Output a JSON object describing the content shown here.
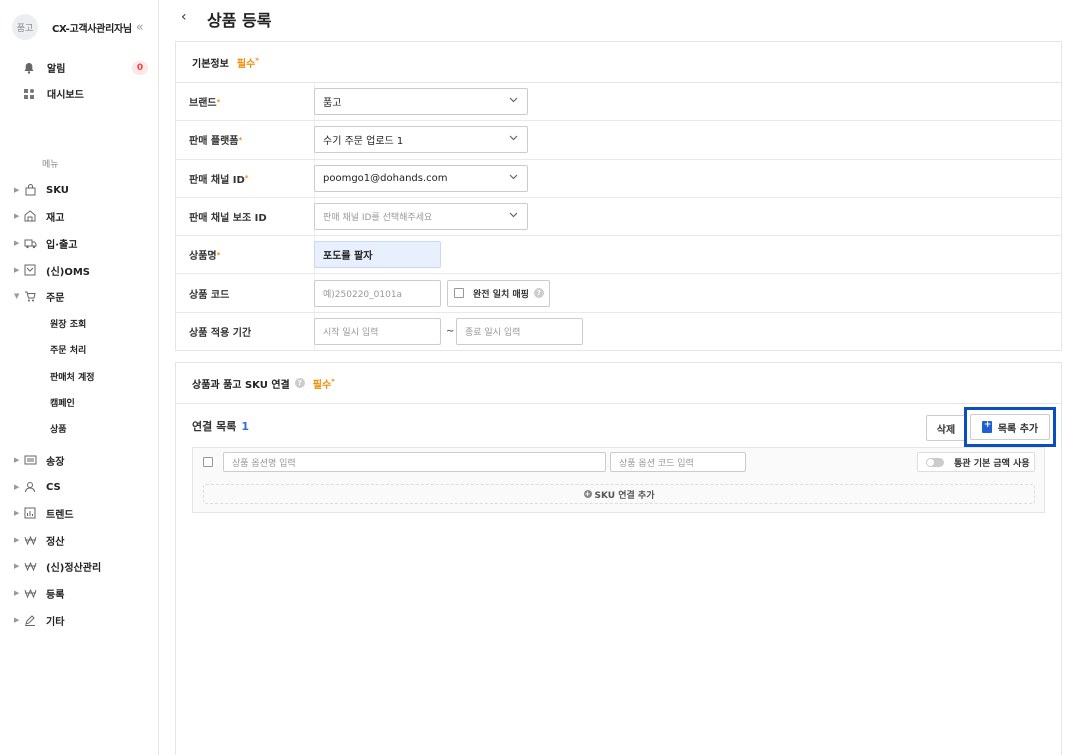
{
  "sidebar": {
    "avatar": "품고",
    "brand_name": "CX-고객사관리자님",
    "collapse": "«",
    "alerts": {
      "label": "알림",
      "count": "0"
    },
    "dashboard": {
      "label": "대시보드"
    },
    "menu_heading": "메뉴",
    "items": [
      {
        "label": "SKU",
        "icon": "bag-icon"
      },
      {
        "label": "재고",
        "icon": "warehouse-icon"
      },
      {
        "label": "입·출고",
        "icon": "truck-icon"
      },
      {
        "label": "(신)OMS",
        "icon": "oms-icon"
      },
      {
        "label": "주문",
        "icon": "cart-icon"
      },
      {
        "label": "송장",
        "icon": "invoice-icon"
      },
      {
        "label": "CS",
        "icon": "person-icon"
      },
      {
        "label": "트렌드",
        "icon": "chart-icon"
      },
      {
        "label": "정산",
        "icon": "won-icon"
      },
      {
        "label": "(신)정산관리",
        "icon": "won-icon"
      },
      {
        "label": "등록",
        "icon": "won-icon"
      },
      {
        "label": "기타",
        "icon": "pencil-icon"
      }
    ],
    "order_sub": [
      "원장 조회",
      "주문 처리",
      "판매처 계정",
      "캠페인",
      "상품"
    ]
  },
  "header": {
    "back": "‹",
    "title": "상품 등록"
  },
  "basic": {
    "title": "기본정보",
    "required": "필수",
    "brand": {
      "label": "브랜드",
      "value": "품고"
    },
    "platform": {
      "label": "판매 플랫폼",
      "value": "수기 주문 업로드 1"
    },
    "channel_id": {
      "label": "판매 채널 ID",
      "value": "poomgo1@dohands.com"
    },
    "sub_channel": {
      "label": "판매 채널 보조 ID",
      "placeholder": "판매 채널 ID를 선택해주세요"
    },
    "product_name": {
      "label": "상품명",
      "value": "포도를 팔자"
    },
    "product_code": {
      "label": "상품 코드",
      "placeholder": "예)250220_0101a",
      "exact_match": "완전 일치 매핑"
    },
    "period": {
      "label": "상품 적용 기간",
      "start_placeholder": "시작 일시 입력",
      "sep": "~",
      "end_placeholder": "종료 일시 입력"
    }
  },
  "link": {
    "title": "상품과 품고 SKU 연결",
    "required": "필수",
    "list_title": "연결 목록",
    "count": "1",
    "delete_label": "삭제",
    "add_label": "목록 추가",
    "option_name_placeholder": "상품 옵션명 입력",
    "option_code_placeholder": "상품 옵션 코드 입력",
    "toggle_label": "통관 기본 금액 사용",
    "sku_add_label": "SKU 연결 추가"
  }
}
